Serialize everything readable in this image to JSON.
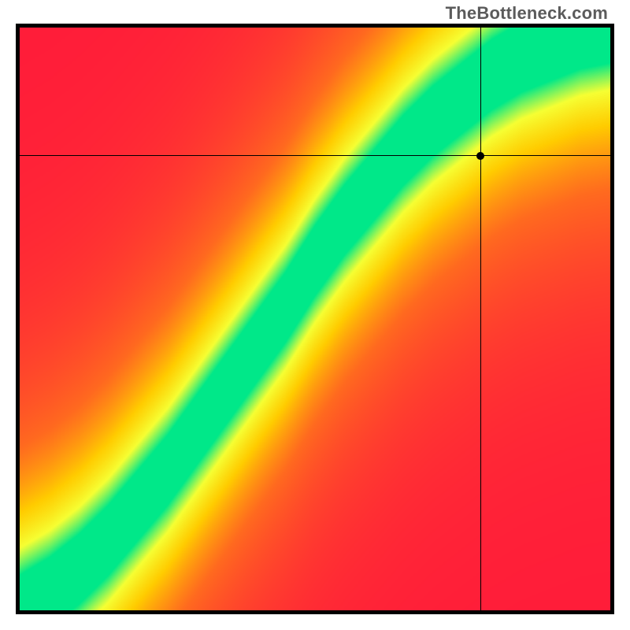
{
  "watermark": "TheBottleneck.com",
  "chart_data": {
    "type": "heatmap",
    "title": "",
    "xlabel": "",
    "ylabel": "",
    "xlim": [
      0,
      1
    ],
    "ylim": [
      0,
      1
    ],
    "grid": false,
    "legend": false,
    "colormap_stops": [
      {
        "v": 0.0,
        "color": "#ff1a3a"
      },
      {
        "v": 0.35,
        "color": "#ff6a1f"
      },
      {
        "v": 0.6,
        "color": "#ffcc00"
      },
      {
        "v": 0.8,
        "color": "#f6ff33"
      },
      {
        "v": 1.0,
        "color": "#00e889"
      }
    ],
    "optimal_curve": [
      {
        "x": 0.0,
        "y": 0.0
      },
      {
        "x": 0.05,
        "y": 0.03
      },
      {
        "x": 0.1,
        "y": 0.07
      },
      {
        "x": 0.15,
        "y": 0.12
      },
      {
        "x": 0.2,
        "y": 0.18
      },
      {
        "x": 0.25,
        "y": 0.24
      },
      {
        "x": 0.3,
        "y": 0.31
      },
      {
        "x": 0.35,
        "y": 0.38
      },
      {
        "x": 0.4,
        "y": 0.45
      },
      {
        "x": 0.45,
        "y": 0.52
      },
      {
        "x": 0.5,
        "y": 0.6
      },
      {
        "x": 0.55,
        "y": 0.67
      },
      {
        "x": 0.6,
        "y": 0.73
      },
      {
        "x": 0.65,
        "y": 0.79
      },
      {
        "x": 0.7,
        "y": 0.84
      },
      {
        "x": 0.75,
        "y": 0.88
      },
      {
        "x": 0.8,
        "y": 0.92
      },
      {
        "x": 0.85,
        "y": 0.95
      },
      {
        "x": 0.9,
        "y": 0.97
      },
      {
        "x": 0.95,
        "y": 0.99
      },
      {
        "x": 1.0,
        "y": 1.0
      }
    ],
    "band_half_width": 0.06,
    "falloff": 0.95,
    "crosshair": {
      "x": 0.78,
      "y": 0.78
    },
    "marker": {
      "x": 0.78,
      "y": 0.78
    }
  },
  "plot_geometry": {
    "inner_left": 5,
    "inner_top": 5,
    "inner_width": 750,
    "inner_height": 740
  }
}
